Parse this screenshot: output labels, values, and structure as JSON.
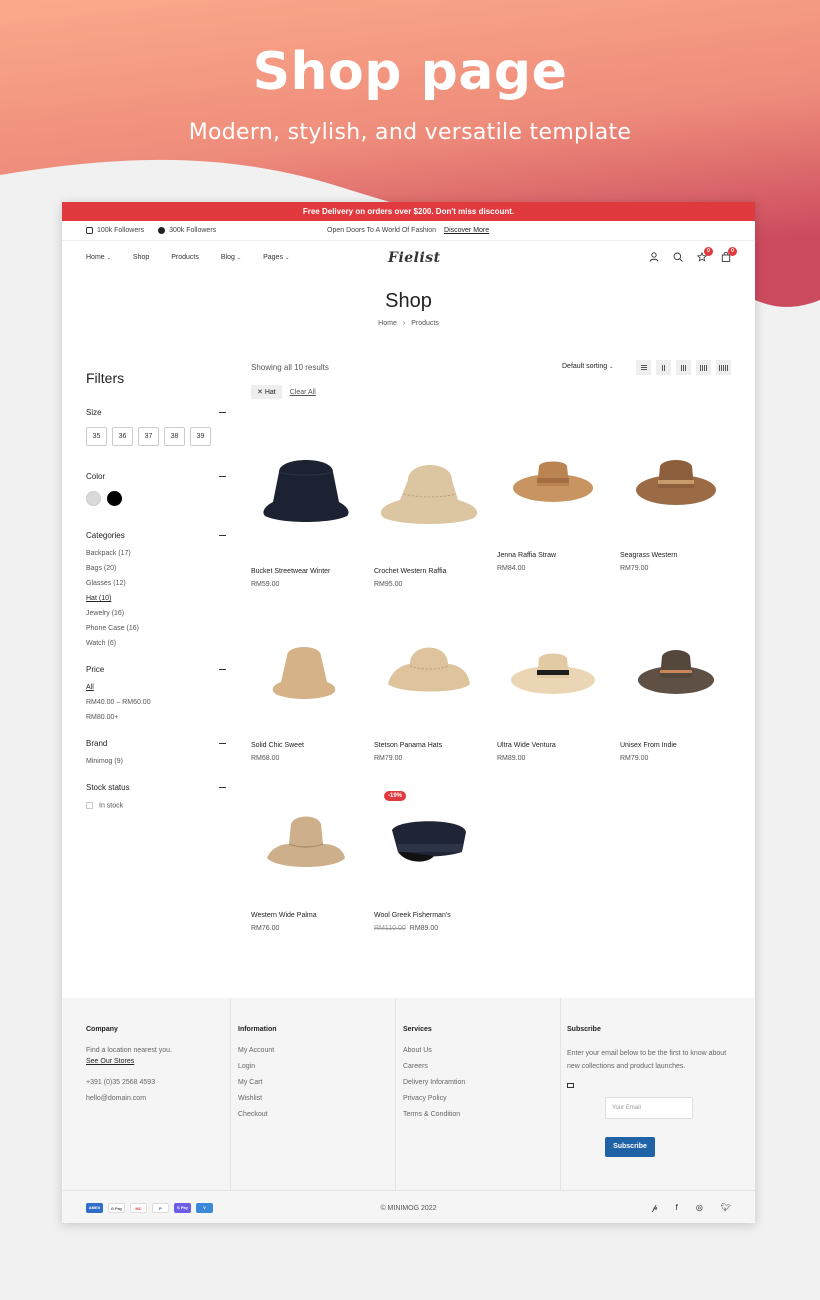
{
  "promo": {
    "title": "Shop page",
    "subtitle": "Modern, stylish, and versatile template"
  },
  "colors": {
    "accent": "#e0393e",
    "subscribe": "#1f63a6"
  },
  "announcement": "Free Delivery on orders over $200. Don't miss discount.",
  "topbar": {
    "instagram": "100k Followers",
    "facebook": "300k Followers",
    "tagline": "Open Doors To A World Of Fashion",
    "discover": "Discover More"
  },
  "nav": {
    "items": [
      "Home",
      "Shop",
      "Products",
      "Blog",
      "Pages"
    ],
    "logo": "Fielist",
    "wishlist_count": "0",
    "cart_count": "0"
  },
  "hero": {
    "title": "Shop",
    "crumbs": [
      "Home",
      "Products"
    ],
    "sep": "›"
  },
  "filters": {
    "title": "Filters",
    "size_label": "Size",
    "sizes": [
      "35",
      "36",
      "37",
      "38",
      "39"
    ],
    "color_label": "Color",
    "colors": [
      "#d9d9d9",
      "#000000"
    ],
    "categories_label": "Categories",
    "categories": [
      {
        "name": "Backpack",
        "count": "(17)"
      },
      {
        "name": "Bags",
        "count": "(20)"
      },
      {
        "name": "Glasses",
        "count": "(12)"
      },
      {
        "name": "Hat",
        "count": "(10)"
      },
      {
        "name": "Jewelry",
        "count": "(16)"
      },
      {
        "name": "Phone Case",
        "count": "(16)"
      },
      {
        "name": "Watch",
        "count": "(6)"
      }
    ],
    "price_label": "Price",
    "prices": [
      "All",
      "RM40.00 – RM60.00",
      "RM80.00+"
    ],
    "brand_label": "Brand",
    "brand": "Minimog",
    "brand_count": "(9)",
    "stock_label": "Stock status",
    "stock": "In stock"
  },
  "toolbar": {
    "results": "Showing all 10 results",
    "sorting": "Default sorting",
    "chip": "Hat",
    "chip_x": "✕",
    "clear": "Clear All"
  },
  "products": [
    {
      "name": "Bucket Streetwear Winter",
      "price": "RM59.00"
    },
    {
      "name": "Crochet Western Raffia",
      "price": "RM95.00"
    },
    {
      "name": "Jenna Raffia Straw",
      "price": "RM84.00"
    },
    {
      "name": "Seagrass Western",
      "price": "RM79.00"
    },
    {
      "name": "Solid Chic Sweet",
      "price": "RM68.00"
    },
    {
      "name": "Stetson Panama Hats",
      "price": "RM79.00"
    },
    {
      "name": "Ultra Wide Ventura",
      "price": "RM89.00"
    },
    {
      "name": "Unisex From Indie",
      "price": "RM79.00"
    },
    {
      "name": "Western Wide Palma",
      "price": "RM76.00"
    },
    {
      "name": "Wool Greek Fisherman's",
      "price": "RM89.00",
      "old_price": "RM110.00",
      "badge": "-19%"
    }
  ],
  "footer": {
    "company": {
      "title": "Company",
      "line1": "Find a location nearest you.",
      "link": "See Our Stores",
      "phone": "+391 (0)35 2568 4593",
      "email": "hello@domain.com"
    },
    "information": {
      "title": "Information",
      "links": [
        "My Account",
        "Login",
        "My Cart",
        "Wishlist",
        "Checkout"
      ]
    },
    "services": {
      "title": "Services",
      "links": [
        "About Us",
        "Careers",
        "Delivery Inforamtion",
        "Privacy Policy",
        "Terms & Condition"
      ]
    },
    "subscribe": {
      "title": "Subscribe",
      "text": "Enter your email below to be the first to know about new collections and product launches.",
      "placeholder": "Your Email",
      "button": "Subscribe"
    },
    "payments": [
      "AMEX",
      "G Pay",
      "MC",
      "P",
      "S Pay",
      "V"
    ],
    "copyright": "© MINIMOG 2022",
    "social": [
      "pinterest-icon",
      "facebook-icon",
      "instagram-icon",
      "twitter-icon"
    ]
  }
}
